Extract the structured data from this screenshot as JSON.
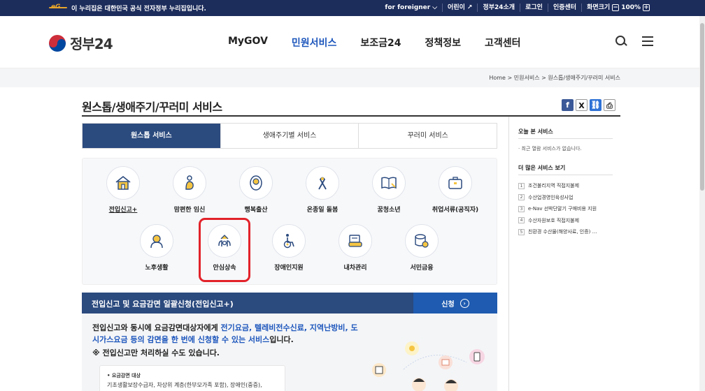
{
  "govbar": {
    "notice": "이 누리집은 대한민국 공식 전자정부 누리집입니다.",
    "eg_logo": "eG",
    "links": [
      "for foreigner",
      "어린이",
      "정부24소개",
      "로그인",
      "인증센터"
    ],
    "zoom_label": "화면크기",
    "zoom_value": "100%",
    "zoom_minus": "−",
    "zoom_plus": "+"
  },
  "header": {
    "logo_text": "정부24",
    "nav": [
      "MyGOV",
      "민원서비스",
      "보조금24",
      "정책정보",
      "고객센터"
    ],
    "active_nav": "민원서비스"
  },
  "breadcrumb": [
    "Home",
    "민원서비스",
    "원스톱/생애주기/꾸러미 서비스"
  ],
  "page_title": "원스톱/생애주기/꾸러미 서비스",
  "share_icons": [
    "facebook-icon",
    "x-icon",
    "link-icon",
    "print-icon"
  ],
  "tabs": [
    "원스톱 서비스",
    "생애주기별 서비스",
    "꾸러미 서비스"
  ],
  "services": [
    {
      "label": "전입신고+",
      "icon": "house-icon",
      "active": true
    },
    {
      "label": "맘편한 임신",
      "icon": "pregnancy-icon"
    },
    {
      "label": "행복출산",
      "icon": "baby-icon"
    },
    {
      "label": "온종일 돌봄",
      "icon": "care-ribbon-icon"
    },
    {
      "label": "꿈청소년",
      "icon": "book-icon"
    },
    {
      "label": "취업서류(공직자)",
      "icon": "briefcase-icon"
    },
    {
      "label": "노후생활",
      "icon": "elder-icon"
    },
    {
      "label": "안심상속",
      "icon": "inheritance-icon"
    },
    {
      "label": "장애인지원",
      "icon": "wheelchair-icon"
    },
    {
      "label": "내차관리",
      "icon": "car-icon"
    },
    {
      "label": "서민금융",
      "icon": "coins-icon"
    }
  ],
  "infobar": {
    "title": "전입신고 및 요금감면 일괄신청(전입신고+)",
    "apply": "신청"
  },
  "description": {
    "line1_a": "전입신고와 동시에 요금감면대상자에게 ",
    "line1_hl": "전기요금, 텔레비전수신료, 지역난방비, 도시가스요금 등의 감면을 한 번에 신청할 수 있는 서비스",
    "line1_b": "입니다.",
    "note": "※ 전입신고만 처리하실 수도 있습니다.",
    "card_title": "• 요금감면 대상",
    "card_body": "기초생활보장수급자, 차상위 계층(한부모가족 포함), 장애인(중증),"
  },
  "sidebar": {
    "recent_title": "오늘 본 서비스",
    "recent_empty": "· 최근 열람 서비스가 없습니다.",
    "more_title": "더 많은 서비스 보기",
    "more_items": [
      "조건불리지역 직접지불제",
      "수산업경영인육성사업",
      "e-Nav 선박단말기 구매비용 지원",
      "수산자원보호 직접지불제",
      "친환경 수산물(해양사료, 인증) …"
    ]
  },
  "colors": {
    "govbar": "#1c2c5b",
    "accent": "#1d56bc",
    "tab_active": "#2b4a7e",
    "highlight": "#e2222a"
  }
}
